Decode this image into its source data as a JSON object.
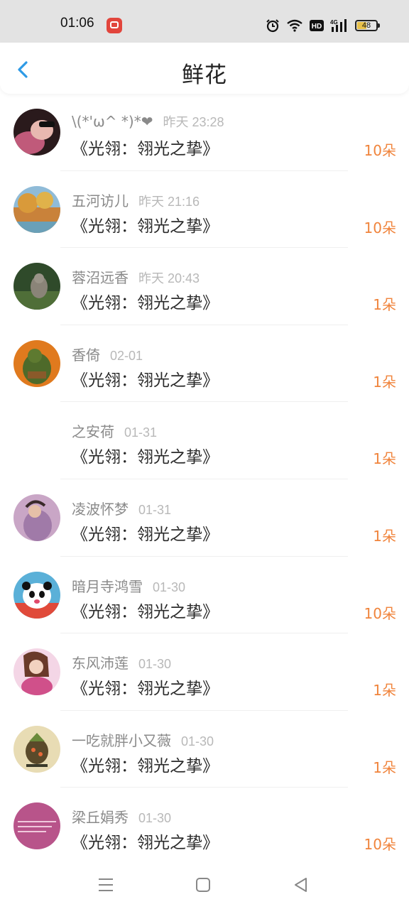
{
  "status_bar": {
    "time": "01:06",
    "battery": "48",
    "icons": [
      "app-badge-icon",
      "alarm-icon",
      "wifi-icon",
      "hd-icon",
      "signal-4g-icon",
      "battery-icon"
    ],
    "hd_label": "HD",
    "network_label": "4G"
  },
  "header": {
    "title": "鲜花",
    "back_icon": "chevron-left-icon",
    "accent": "#2e9ae6"
  },
  "list": [
    {
      "user": "\\(*'ω^ *)*❤",
      "time": "昨天 23:28",
      "book": "《光翎：翎光之挚》",
      "amount": "10朵"
    },
    {
      "user": "五河访儿",
      "time": "昨天 21:16",
      "book": "《光翎：翎光之挚》",
      "amount": "10朵"
    },
    {
      "user": "蓉沼远香",
      "time": "昨天 20:43",
      "book": "《光翎：翎光之挚》",
      "amount": "1朵"
    },
    {
      "user": "香倚",
      "time": "02-01",
      "book": "《光翎：翎光之挚》",
      "amount": "1朵"
    },
    {
      "user": "之安荷",
      "time": "01-31",
      "book": "《光翎：翎光之挚》",
      "amount": "1朵"
    },
    {
      "user": "凌波怀梦",
      "time": "01-31",
      "book": "《光翎：翎光之挚》",
      "amount": "1朵"
    },
    {
      "user": "暗月寺鸿雪",
      "time": "01-30",
      "book": "《光翎：翎光之挚》",
      "amount": "10朵"
    },
    {
      "user": "东风沛莲",
      "time": "01-30",
      "book": "《光翎：翎光之挚》",
      "amount": "1朵"
    },
    {
      "user": "一吃就胖小又薇",
      "time": "01-30",
      "book": "《光翎：翎光之挚》",
      "amount": "1朵"
    },
    {
      "user": "梁丘娟秀",
      "time": "01-30",
      "book": "《光翎：翎光之挚》",
      "amount": "10朵"
    }
  ],
  "colors": {
    "amount": "#f0843c",
    "username": "#8a8a8a",
    "timestamp": "#b8b8b8"
  },
  "nav_bar": {
    "icons": [
      "menu-icon",
      "home-square-icon",
      "back-triangle-icon"
    ]
  }
}
